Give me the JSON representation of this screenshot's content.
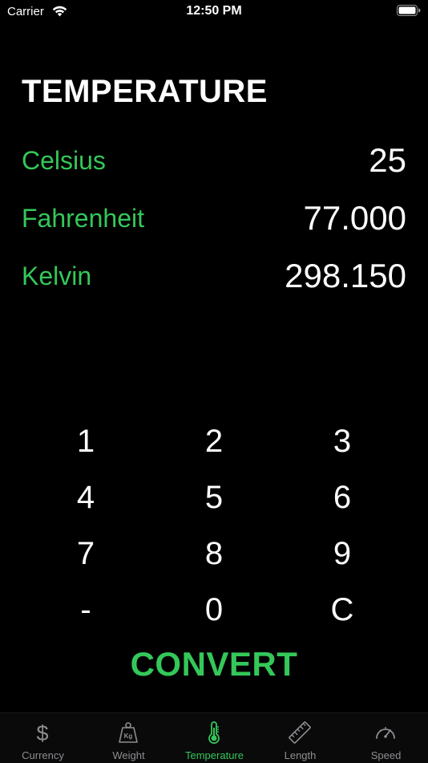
{
  "status_bar": {
    "carrier": "Carrier",
    "time": "12:50 PM"
  },
  "page": {
    "title": "TEMPERATURE"
  },
  "units": [
    {
      "name": "Celsius",
      "value": "25"
    },
    {
      "name": "Fahrenheit",
      "value": "77.000"
    },
    {
      "name": "Kelvin",
      "value": "298.150"
    }
  ],
  "keypad": {
    "keys": [
      "1",
      "2",
      "3",
      "4",
      "5",
      "6",
      "7",
      "8",
      "9",
      "-",
      "0",
      "C"
    ]
  },
  "convert_label": "CONVERT",
  "tab_bar": {
    "active_index": 2,
    "tabs": [
      {
        "label": "Currency",
        "icon": "dollar-icon"
      },
      {
        "label": "Weight",
        "icon": "weight-kg-icon"
      },
      {
        "label": "Temperature",
        "icon": "thermometer-icon"
      },
      {
        "label": "Length",
        "icon": "ruler-icon"
      },
      {
        "label": "Speed",
        "icon": "speedometer-icon"
      }
    ]
  },
  "colors": {
    "accent": "#34c759",
    "background": "#000000",
    "inactive_tab": "#8e8e93"
  }
}
